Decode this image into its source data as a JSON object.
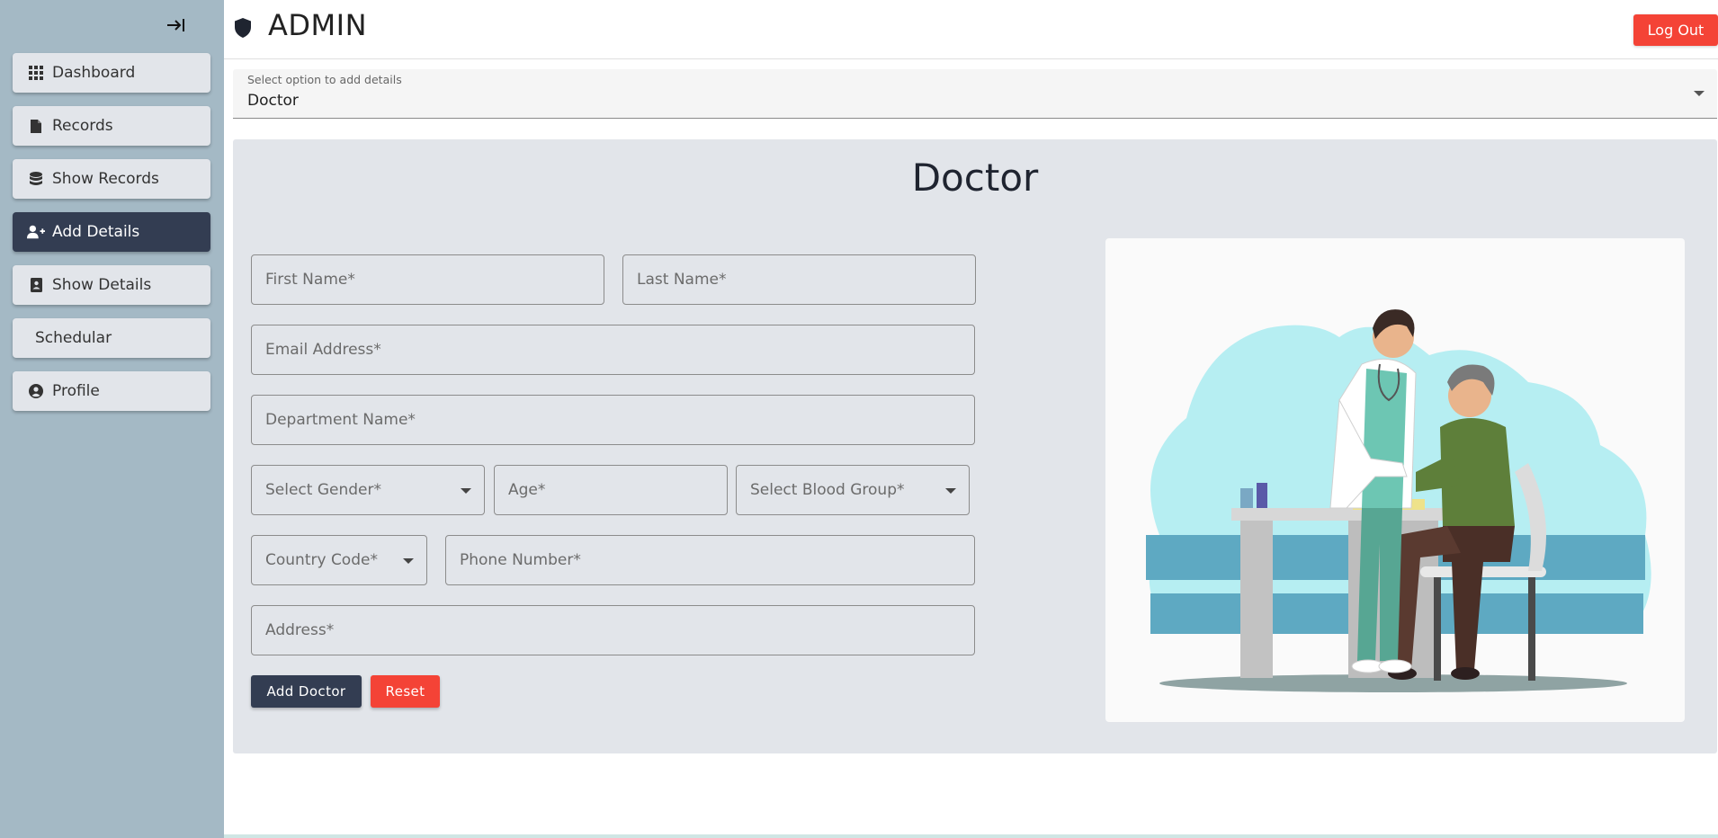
{
  "sidebar": {
    "items": [
      {
        "label": "Dashboard",
        "icon": "grid-icon"
      },
      {
        "label": "Records",
        "icon": "file-icon"
      },
      {
        "label": "Show Records",
        "icon": "database-icon"
      },
      {
        "label": "Add Details",
        "icon": "user-plus-icon",
        "active": true
      },
      {
        "label": "Show Details",
        "icon": "contact-book-icon"
      },
      {
        "label": "Schedular",
        "icon": ""
      },
      {
        "label": "Profile",
        "icon": "user-circle-icon"
      }
    ]
  },
  "header": {
    "title": "ADMIN",
    "logout_label": "Log Out"
  },
  "select_option": {
    "label": "Select option to add details",
    "value": "Doctor"
  },
  "form": {
    "title": "Doctor",
    "first_name": "First Name*",
    "last_name": "Last Name*",
    "email": "Email Address*",
    "department": "Department Name*",
    "gender": "Select Gender*",
    "age": "Age*",
    "blood_group": "Select Blood Group*",
    "country_code": "Country Code*",
    "phone": "Phone Number*",
    "address": "Address*",
    "add_button": "Add Doctor",
    "reset_button": "Reset"
  },
  "colors": {
    "sidebar_bg": "#a4b9c5",
    "active_nav": "#333d52",
    "danger": "#f44336",
    "panel_bg": "#e2e5ea"
  }
}
